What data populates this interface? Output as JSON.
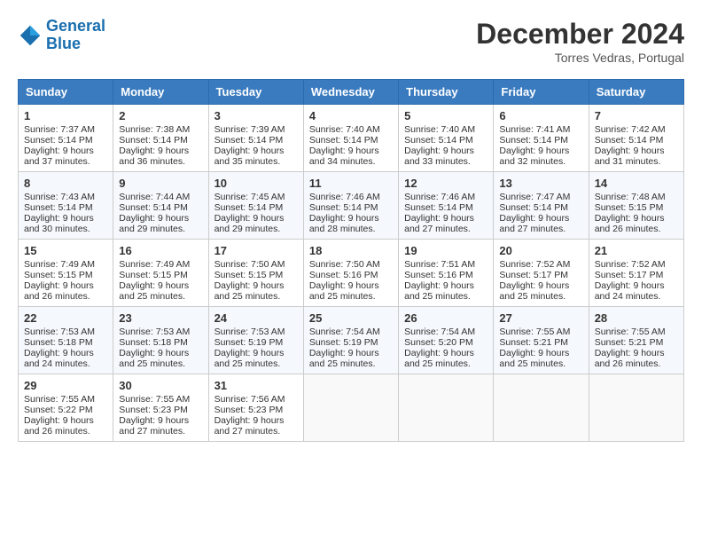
{
  "header": {
    "logo_line1": "General",
    "logo_line2": "Blue",
    "month_title": "December 2024",
    "location": "Torres Vedras, Portugal"
  },
  "days_of_week": [
    "Sunday",
    "Monday",
    "Tuesday",
    "Wednesday",
    "Thursday",
    "Friday",
    "Saturday"
  ],
  "weeks": [
    [
      {
        "day": "1",
        "lines": [
          "Sunrise: 7:37 AM",
          "Sunset: 5:14 PM",
          "Daylight: 9 hours",
          "and 37 minutes."
        ]
      },
      {
        "day": "2",
        "lines": [
          "Sunrise: 7:38 AM",
          "Sunset: 5:14 PM",
          "Daylight: 9 hours",
          "and 36 minutes."
        ]
      },
      {
        "day": "3",
        "lines": [
          "Sunrise: 7:39 AM",
          "Sunset: 5:14 PM",
          "Daylight: 9 hours",
          "and 35 minutes."
        ]
      },
      {
        "day": "4",
        "lines": [
          "Sunrise: 7:40 AM",
          "Sunset: 5:14 PM",
          "Daylight: 9 hours",
          "and 34 minutes."
        ]
      },
      {
        "day": "5",
        "lines": [
          "Sunrise: 7:40 AM",
          "Sunset: 5:14 PM",
          "Daylight: 9 hours",
          "and 33 minutes."
        ]
      },
      {
        "day": "6",
        "lines": [
          "Sunrise: 7:41 AM",
          "Sunset: 5:14 PM",
          "Daylight: 9 hours",
          "and 32 minutes."
        ]
      },
      {
        "day": "7",
        "lines": [
          "Sunrise: 7:42 AM",
          "Sunset: 5:14 PM",
          "Daylight: 9 hours",
          "and 31 minutes."
        ]
      }
    ],
    [
      {
        "day": "8",
        "lines": [
          "Sunrise: 7:43 AM",
          "Sunset: 5:14 PM",
          "Daylight: 9 hours",
          "and 30 minutes."
        ]
      },
      {
        "day": "9",
        "lines": [
          "Sunrise: 7:44 AM",
          "Sunset: 5:14 PM",
          "Daylight: 9 hours",
          "and 29 minutes."
        ]
      },
      {
        "day": "10",
        "lines": [
          "Sunrise: 7:45 AM",
          "Sunset: 5:14 PM",
          "Daylight: 9 hours",
          "and 29 minutes."
        ]
      },
      {
        "day": "11",
        "lines": [
          "Sunrise: 7:46 AM",
          "Sunset: 5:14 PM",
          "Daylight: 9 hours",
          "and 28 minutes."
        ]
      },
      {
        "day": "12",
        "lines": [
          "Sunrise: 7:46 AM",
          "Sunset: 5:14 PM",
          "Daylight: 9 hours",
          "and 27 minutes."
        ]
      },
      {
        "day": "13",
        "lines": [
          "Sunrise: 7:47 AM",
          "Sunset: 5:14 PM",
          "Daylight: 9 hours",
          "and 27 minutes."
        ]
      },
      {
        "day": "14",
        "lines": [
          "Sunrise: 7:48 AM",
          "Sunset: 5:15 PM",
          "Daylight: 9 hours",
          "and 26 minutes."
        ]
      }
    ],
    [
      {
        "day": "15",
        "lines": [
          "Sunrise: 7:49 AM",
          "Sunset: 5:15 PM",
          "Daylight: 9 hours",
          "and 26 minutes."
        ]
      },
      {
        "day": "16",
        "lines": [
          "Sunrise: 7:49 AM",
          "Sunset: 5:15 PM",
          "Daylight: 9 hours",
          "and 25 minutes."
        ]
      },
      {
        "day": "17",
        "lines": [
          "Sunrise: 7:50 AM",
          "Sunset: 5:15 PM",
          "Daylight: 9 hours",
          "and 25 minutes."
        ]
      },
      {
        "day": "18",
        "lines": [
          "Sunrise: 7:50 AM",
          "Sunset: 5:16 PM",
          "Daylight: 9 hours",
          "and 25 minutes."
        ]
      },
      {
        "day": "19",
        "lines": [
          "Sunrise: 7:51 AM",
          "Sunset: 5:16 PM",
          "Daylight: 9 hours",
          "and 25 minutes."
        ]
      },
      {
        "day": "20",
        "lines": [
          "Sunrise: 7:52 AM",
          "Sunset: 5:17 PM",
          "Daylight: 9 hours",
          "and 25 minutes."
        ]
      },
      {
        "day": "21",
        "lines": [
          "Sunrise: 7:52 AM",
          "Sunset: 5:17 PM",
          "Daylight: 9 hours",
          "and 24 minutes."
        ]
      }
    ],
    [
      {
        "day": "22",
        "lines": [
          "Sunrise: 7:53 AM",
          "Sunset: 5:18 PM",
          "Daylight: 9 hours",
          "and 24 minutes."
        ]
      },
      {
        "day": "23",
        "lines": [
          "Sunrise: 7:53 AM",
          "Sunset: 5:18 PM",
          "Daylight: 9 hours",
          "and 25 minutes."
        ]
      },
      {
        "day": "24",
        "lines": [
          "Sunrise: 7:53 AM",
          "Sunset: 5:19 PM",
          "Daylight: 9 hours",
          "and 25 minutes."
        ]
      },
      {
        "day": "25",
        "lines": [
          "Sunrise: 7:54 AM",
          "Sunset: 5:19 PM",
          "Daylight: 9 hours",
          "and 25 minutes."
        ]
      },
      {
        "day": "26",
        "lines": [
          "Sunrise: 7:54 AM",
          "Sunset: 5:20 PM",
          "Daylight: 9 hours",
          "and 25 minutes."
        ]
      },
      {
        "day": "27",
        "lines": [
          "Sunrise: 7:55 AM",
          "Sunset: 5:21 PM",
          "Daylight: 9 hours",
          "and 25 minutes."
        ]
      },
      {
        "day": "28",
        "lines": [
          "Sunrise: 7:55 AM",
          "Sunset: 5:21 PM",
          "Daylight: 9 hours",
          "and 26 minutes."
        ]
      }
    ],
    [
      {
        "day": "29",
        "lines": [
          "Sunrise: 7:55 AM",
          "Sunset: 5:22 PM",
          "Daylight: 9 hours",
          "and 26 minutes."
        ]
      },
      {
        "day": "30",
        "lines": [
          "Sunrise: 7:55 AM",
          "Sunset: 5:23 PM",
          "Daylight: 9 hours",
          "and 27 minutes."
        ]
      },
      {
        "day": "31",
        "lines": [
          "Sunrise: 7:56 AM",
          "Sunset: 5:23 PM",
          "Daylight: 9 hours",
          "and 27 minutes."
        ]
      },
      {
        "day": "",
        "lines": []
      },
      {
        "day": "",
        "lines": []
      },
      {
        "day": "",
        "lines": []
      },
      {
        "day": "",
        "lines": []
      }
    ]
  ]
}
